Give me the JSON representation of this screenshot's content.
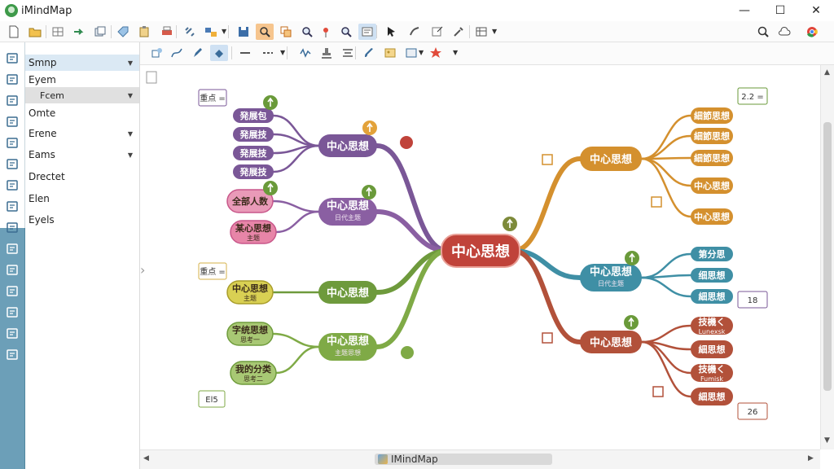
{
  "app": {
    "title": "iMindMap"
  },
  "window_controls": {
    "minimize": "—",
    "maximize": "☐",
    "close": "✕"
  },
  "toolbar_primary": {
    "icons": [
      "new-document-icon",
      "open-folder-icon",
      "grid-icon",
      "forward-arrow-icon",
      "copy-icon",
      "tag-icon",
      "paste-icon",
      "print-icon",
      "link-icon",
      "layout-icon",
      "save-icon",
      "zoom-icon",
      "copy-map-icon",
      "search-icon",
      "pin-icon",
      "search-icon",
      "notes-icon",
      "cursor-icon",
      "branch-icon",
      "export-icon",
      "tools-icon",
      "table-icon"
    ],
    "active_index": 11,
    "pressed_index": 16,
    "right_icons": [
      "magnifier-icon",
      "cloud-icon",
      "chrome-icon",
      "close-icon"
    ]
  },
  "toolbar_secondary": {
    "icons": [
      "shape-icon",
      "curve-icon",
      "pen-icon",
      "fill-icon",
      "line-style-icon",
      "dash-icon",
      "wave-icon",
      "stamp-icon",
      "align-icon",
      "brush-icon",
      "image-icon",
      "box-icon",
      "star-icon"
    ]
  },
  "menu": {
    "items": [
      {
        "label": "Smnp",
        "has_dropdown": true
      },
      {
        "label": "Eyem",
        "has_dropdown": false
      },
      {
        "label": "Fcem",
        "has_dropdown": true
      },
      {
        "label": "Omte",
        "has_dropdown": false
      },
      {
        "label": "Erene",
        "has_dropdown": true
      },
      {
        "label": "Eams",
        "has_dropdown": true
      },
      {
        "label": "Drectet",
        "has_dropdown": false
      },
      {
        "label": "Elen",
        "has_dropdown": false
      },
      {
        "label": "Eyels",
        "has_dropdown": false
      }
    ]
  },
  "mindmap": {
    "central": {
      "label": "中心思想",
      "color": "#c0433a"
    },
    "branches": [
      {
        "label": "中心思想",
        "sublabel": "",
        "color": "#7a5797",
        "children": [
          {
            "label": "発展包"
          },
          {
            "label": "発展技"
          },
          {
            "label": "発展技"
          },
          {
            "label": "発展技"
          }
        ],
        "note": "重点 ="
      },
      {
        "label": "中心思想",
        "sublabel": "日代主题",
        "color": "#8a5fa2",
        "children": [
          {
            "label": "全部人数",
            "sublabel": ""
          },
          {
            "label": "某心思想",
            "sublabel": "主题"
          }
        ]
      },
      {
        "label": "中心思想",
        "sublabel": "",
        "color": "#6e9a3c",
        "children": [
          {
            "label": "中心思想",
            "sublabel": "主题"
          }
        ],
        "note": "重点 ="
      },
      {
        "label": "中心思想",
        "sublabel": "主题思想",
        "color": "#7faa46",
        "children": [
          {
            "label": "字统思想",
            "sublabel": "思考一"
          },
          {
            "label": "我的分类",
            "sublabel": "思考二"
          }
        ],
        "note": "El5"
      },
      {
        "label": "中心思想",
        "sublabel": "",
        "color": "#d4902e",
        "children": [
          {
            "label": "細節思想"
          },
          {
            "label": "細節思想"
          },
          {
            "label": "細節思想"
          },
          {
            "label": "中心思想"
          },
          {
            "label": "中心思想"
          }
        ],
        "note": "2.2 ="
      },
      {
        "label": "中心思想",
        "sublabel": "日代主题",
        "color": "#3f8fa5",
        "children": [
          {
            "label": "第分思"
          },
          {
            "label": "细思想"
          },
          {
            "label": "細思想"
          }
        ],
        "note": "18"
      },
      {
        "label": "中心思想",
        "sublabel": "",
        "color": "#b2513a",
        "children": [
          {
            "label": "技機く",
            "sublabel": "Lunexsk"
          },
          {
            "label": "細思想"
          },
          {
            "label": "技機く",
            "sublabel": "Fumisk"
          },
          {
            "label": "細思想"
          }
        ],
        "note": "26"
      }
    ]
  },
  "scrollbar": {
    "tab_label": "IMindMap"
  }
}
